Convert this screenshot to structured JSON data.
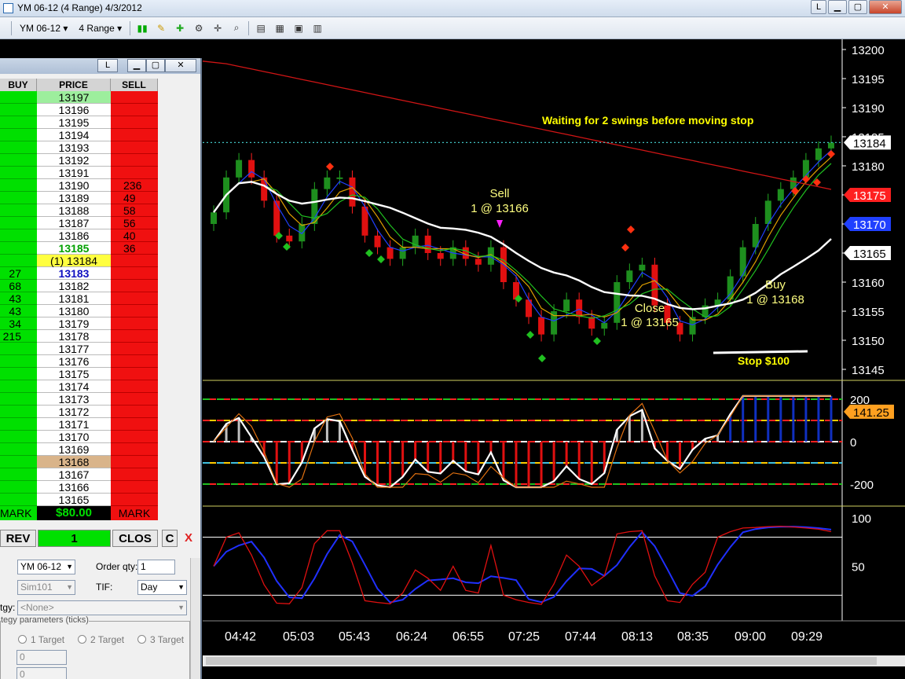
{
  "window": {
    "title": "YM 06-12 (4 Range)  4/3/2012",
    "l_label": "L"
  },
  "toolbar": {
    "instrument": "YM 06-12",
    "interval": "4 Range"
  },
  "dom": {
    "l_label": "L",
    "headers": {
      "buy": "BUY",
      "price": "PRICE",
      "sell": "SELL"
    },
    "rows": [
      {
        "buy": "",
        "price": "13197",
        "sell": ""
      },
      {
        "buy": "",
        "price": "13196",
        "sell": ""
      },
      {
        "buy": "",
        "price": "13195",
        "sell": ""
      },
      {
        "buy": "",
        "price": "13194",
        "sell": ""
      },
      {
        "buy": "",
        "price": "13193",
        "sell": ""
      },
      {
        "buy": "",
        "price": "13192",
        "sell": ""
      },
      {
        "buy": "",
        "price": "13191",
        "sell": ""
      },
      {
        "buy": "",
        "price": "13190",
        "sell": "236"
      },
      {
        "buy": "",
        "price": "13189",
        "sell": "49"
      },
      {
        "buy": "",
        "price": "13188",
        "sell": "58"
      },
      {
        "buy": "",
        "price": "13187",
        "sell": "56"
      },
      {
        "buy": "",
        "price": "13186",
        "sell": "40"
      },
      {
        "buy": "",
        "price": "13185",
        "sell": "36"
      },
      {
        "buy": "",
        "price": "(1) 13184",
        "sell": ""
      },
      {
        "buy": "27",
        "price": "13183",
        "sell": ""
      },
      {
        "buy": "68",
        "price": "13182",
        "sell": ""
      },
      {
        "buy": "43",
        "price": "13181",
        "sell": ""
      },
      {
        "buy": "43",
        "price": "13180",
        "sell": ""
      },
      {
        "buy": "34",
        "price": "13179",
        "sell": ""
      },
      {
        "buy": "215",
        "price": "13178",
        "sell": ""
      },
      {
        "buy": "",
        "price": "13177",
        "sell": ""
      },
      {
        "buy": "",
        "price": "13176",
        "sell": ""
      },
      {
        "buy": "",
        "price": "13175",
        "sell": ""
      },
      {
        "buy": "",
        "price": "13174",
        "sell": ""
      },
      {
        "buy": "",
        "price": "13173",
        "sell": ""
      },
      {
        "buy": "",
        "price": "13172",
        "sell": ""
      },
      {
        "buy": "",
        "price": "13171",
        "sell": ""
      },
      {
        "buy": "",
        "price": "13170",
        "sell": ""
      },
      {
        "buy": "",
        "price": "13169",
        "sell": ""
      },
      {
        "buy": "",
        "price": "13168",
        "sell": ""
      },
      {
        "buy": "",
        "price": "13167",
        "sell": ""
      },
      {
        "buy": "",
        "price": "13166",
        "sell": ""
      },
      {
        "buy": "",
        "price": "13165",
        "sell": ""
      }
    ],
    "mark_buy": "MARK",
    "pnl": "$80.00",
    "mark_sell": "MARK",
    "rev_label": "REV",
    "qty_value": "1",
    "close_label": "CLOS",
    "c_label": "C",
    "x_label": "X",
    "instrument_select": "YM 06-12",
    "account_select": "Sim101",
    "order_qty_label": "Order qty:",
    "order_qty_value": "1",
    "tif_label": "TIF:",
    "tif_value": "Day",
    "strategy_label": "tgy:",
    "strategy_value": "<None>",
    "strategy_params_label": "tegy parameters (ticks)",
    "targets": [
      "1 Target",
      "2 Target",
      "3 Target"
    ],
    "param1": "0",
    "param2": "0"
  },
  "chart_data": [
    {
      "type": "candlestick",
      "title": "",
      "y_ticks": [
        13200,
        13195,
        13190,
        13185,
        13180,
        13175,
        13170,
        13165,
        13160,
        13155,
        13150,
        13145
      ],
      "ylim": [
        13145,
        13202
      ],
      "x_ticks": [
        "04:42",
        "05:03",
        "05:43",
        "06:24",
        "06:55",
        "07:25",
        "07:44",
        "08:13",
        "08:35",
        "09:00",
        "09:29"
      ],
      "price_markers": [
        {
          "value": "13184",
          "color": "#ffffff"
        },
        {
          "value": "13175",
          "color": "#ff2020"
        },
        {
          "value": "13170",
          "color": "#2040ff"
        },
        {
          "value": "13165",
          "color": "#ffffff"
        }
      ],
      "annotations": [
        {
          "text": "Waiting for 2 swings before moving stop",
          "color": "#ffff00"
        },
        {
          "text": "Sell",
          "color": "#ffff80"
        },
        {
          "text": "1 @ 13166",
          "color": "#ffff80"
        },
        {
          "text": "Close",
          "color": "#ffff80"
        },
        {
          "text": "1 @ 13165",
          "color": "#ffff80"
        },
        {
          "text": "Buy",
          "color": "#ffff80"
        },
        {
          "text": "1 @ 13168",
          "color": "#ffff80"
        },
        {
          "text": "Stop $100",
          "color": "#ffff00"
        }
      ],
      "close_series": [
        13172,
        13178,
        13181,
        13178,
        13174,
        13168,
        13167,
        13170,
        13176,
        13178,
        13178,
        13173,
        13168,
        13166,
        13164,
        13166,
        13168,
        13165,
        13164,
        13166,
        13164,
        13163,
        13166,
        13160,
        13157,
        13154,
        13151,
        13155,
        13157,
        13154,
        13152,
        13153,
        13160,
        13162,
        13163,
        13156,
        13153,
        13151,
        13154,
        13156,
        13157,
        13161,
        13166,
        13170,
        13174,
        13176,
        13178,
        13181,
        13183,
        13184
      ]
    },
    {
      "type": "line",
      "title": "",
      "y_ticks": [
        200,
        0,
        -200
      ],
      "ylim": [
        -240,
        230
      ],
      "value_label": "141.25"
    },
    {
      "type": "line",
      "title": "",
      "y_ticks": [
        100,
        50
      ],
      "ylim": [
        0,
        104
      ]
    }
  ]
}
